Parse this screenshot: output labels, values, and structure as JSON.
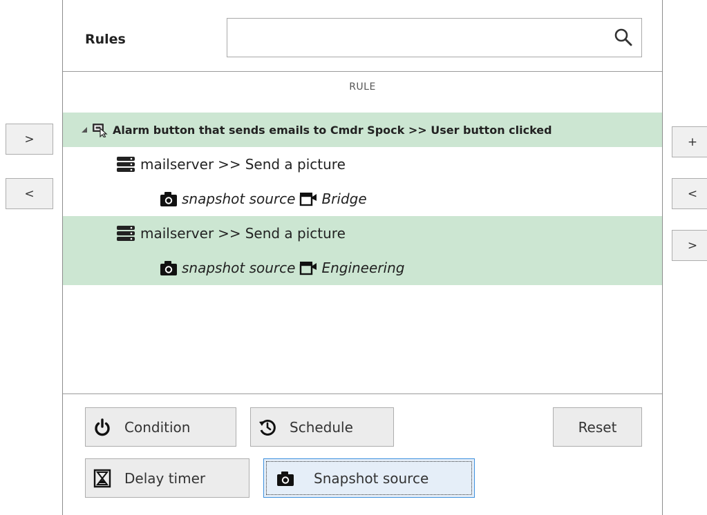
{
  "left_nav": {
    "forward_label": ">",
    "back_label": "<"
  },
  "right_nav": {
    "add_label": "+",
    "back_label": "<",
    "forward_label": ">"
  },
  "rules": {
    "title": "Rules",
    "search": {
      "value": "",
      "placeholder": ""
    },
    "column_header": "RULE",
    "tree": {
      "rule": {
        "label": "Alarm button that sends emails to Cmdr Spock >> User button clicked"
      },
      "actions": [
        {
          "server": "mailserver",
          "separator": ">>",
          "action": "Send a picture",
          "snapshot_label": "snapshot source",
          "camera": "Bridge"
        },
        {
          "server": "mailserver",
          "separator": ">>",
          "action": "Send a picture",
          "snapshot_label": "snapshot source",
          "camera": "Engineering"
        }
      ]
    }
  },
  "buttons": {
    "condition": "Condition",
    "schedule": "Schedule",
    "reset": "Reset",
    "delay_timer": "Delay timer",
    "snapshot_source": "Snapshot source"
  },
  "colors": {
    "selected_row": "#cce6d2",
    "focus_border": "#3c8fde"
  }
}
